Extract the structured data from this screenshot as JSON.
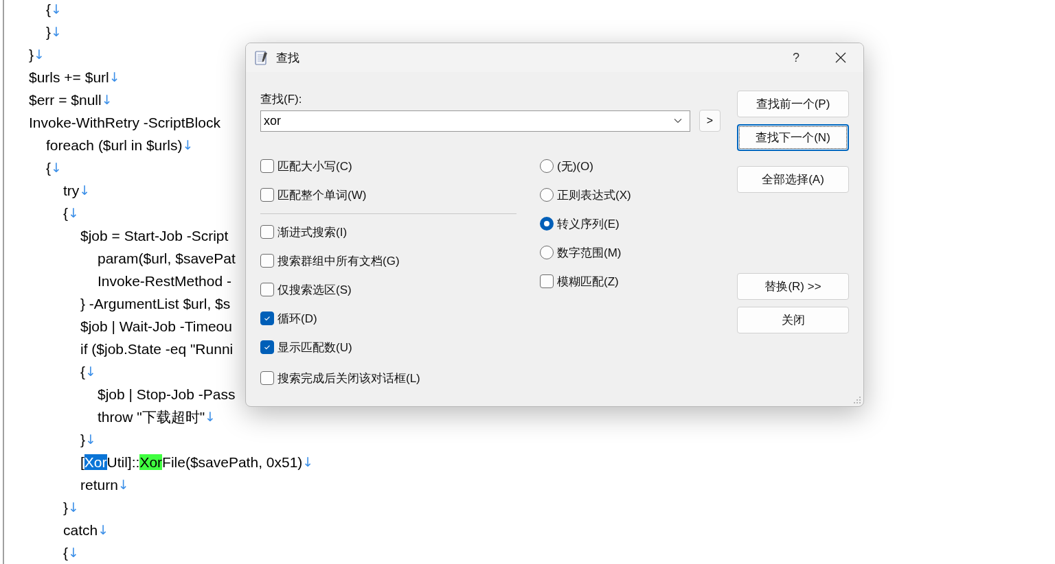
{
  "editor": {
    "lines": [
      {
        "children": [
          {
            "segments": [
              {
                "kind": "plain",
                "text": "{"
              }
            ],
            "eol": "↓"
          },
          {
            "segments": [
              {
                "kind": "plain",
                "text": "}"
              }
            ],
            "eol": "↓"
          }
        ]
      },
      {
        "segments": [
          {
            "kind": "plain",
            "text": "}"
          }
        ],
        "eol": "↓"
      },
      {
        "segments": [
          {
            "kind": "plain",
            "text": "$urls += $url"
          }
        ],
        "eol": "↓"
      },
      {
        "segments": [
          {
            "kind": "plain",
            "text": "$err = $null"
          }
        ],
        "eol": "↓"
      },
      {
        "segments": [
          {
            "kind": "plain",
            "text": "Invoke-WithRetry -ScriptBlock"
          }
        ],
        "children": [
          {
            "segments": [
              {
                "kind": "plain",
                "text": "foreach ($url in $urls)"
              }
            ],
            "eol": "↓"
          },
          {
            "segments": [
              {
                "kind": "plain",
                "text": "{"
              }
            ],
            "eol": "↓",
            "children": [
              {
                "segments": [
                  {
                    "kind": "plain",
                    "text": "try"
                  }
                ],
                "eol": "↓"
              },
              {
                "segments": [
                  {
                    "kind": "plain",
                    "text": "{"
                  }
                ],
                "eol": "↓",
                "children": [
                  {
                    "segments": [
                      {
                        "kind": "plain",
                        "text": "$job = Start-Job -Script"
                      }
                    ],
                    "children": [
                      {
                        "segments": [
                          {
                            "kind": "plain",
                            "text": "param($url, $savePat"
                          }
                        ]
                      },
                      {
                        "segments": [
                          {
                            "kind": "plain",
                            "text": "Invoke-RestMethod -"
                          }
                        ]
                      }
                    ]
                  },
                  {
                    "segments": [
                      {
                        "kind": "plain",
                        "text": "} -ArgumentList $url, $s"
                      }
                    ]
                  },
                  {
                    "segments": [
                      {
                        "kind": "plain",
                        "text": "$job | Wait-Job -Timeou"
                      }
                    ]
                  },
                  {
                    "segments": [
                      {
                        "kind": "plain",
                        "text": "if ($job.State -eq \"Runni"
                      }
                    ]
                  },
                  {
                    "segments": [
                      {
                        "kind": "plain",
                        "text": "{"
                      }
                    ],
                    "eol": "↓",
                    "children": [
                      {
                        "segments": [
                          {
                            "kind": "plain",
                            "text": "$job | Stop-Job -Pass"
                          }
                        ]
                      },
                      {
                        "segments": [
                          {
                            "kind": "plain",
                            "text": "throw \"下载超时\""
                          }
                        ],
                        "eol": "↓"
                      }
                    ]
                  },
                  {
                    "segments": [
                      {
                        "kind": "plain",
                        "text": "}"
                      }
                    ],
                    "eol": "↓"
                  },
                  {
                    "segments": [
                      {
                        "kind": "plain",
                        "text": "["
                      },
                      {
                        "kind": "selected",
                        "text": "Xor"
                      },
                      {
                        "kind": "plain",
                        "text": "Util]::"
                      },
                      {
                        "kind": "match",
                        "text": "Xor"
                      },
                      {
                        "kind": "plain",
                        "text": "File($savePath, 0x51)"
                      }
                    ],
                    "eol": "↓"
                  },
                  {
                    "segments": [
                      {
                        "kind": "plain",
                        "text": "return"
                      }
                    ],
                    "eol": "↓"
                  }
                ]
              },
              {
                "segments": [
                  {
                    "kind": "plain",
                    "text": "}"
                  }
                ],
                "eol": "↓"
              },
              {
                "segments": [
                  {
                    "kind": "plain",
                    "text": "catch"
                  }
                ],
                "eol": "↓"
              },
              {
                "segments": [
                  {
                    "kind": "plain",
                    "text": "{"
                  }
                ],
                "eol": "↓"
              }
            ]
          }
        ]
      }
    ]
  },
  "dialog": {
    "title": "查找",
    "help": "?",
    "find_label": "查找(F):",
    "find_field": {
      "value": "xor"
    },
    "expand_button": ">",
    "match_options": [
      {
        "label": "匹配大小写(C)",
        "checked": false
      },
      {
        "label": "匹配整个单词(W)",
        "checked": false
      }
    ],
    "search_options": [
      {
        "label": "渐进式搜索(I)",
        "checked": false
      },
      {
        "label": "搜索群组中所有文档(G)",
        "checked": false
      },
      {
        "label": "仅搜索选区(S)",
        "checked": false
      },
      {
        "label": "循环(D)",
        "checked": true
      },
      {
        "label": "显示匹配数(U)",
        "checked": true
      },
      {
        "label": "搜索完成后关闭该对话框(L)",
        "checked": false
      }
    ],
    "search_mode": [
      {
        "label": "(无)(O)",
        "selected": false
      },
      {
        "label": "正则表达式(X)",
        "selected": false
      },
      {
        "label": "转义序列(E)",
        "selected": true
      },
      {
        "label": "数字范围(M)",
        "selected": false
      }
    ],
    "fuzzy_match": {
      "label": "模糊匹配(Z)",
      "checked": false
    },
    "buttons": [
      {
        "label": "查找前一个(P)",
        "focused": false
      },
      {
        "label": "查找下一个(N)",
        "focused": true
      },
      {
        "label": "全部选择(A)",
        "focused": false
      },
      {
        "label": "替换(R) >>",
        "focused": false
      },
      {
        "label": "关闭",
        "focused": false
      }
    ]
  }
}
